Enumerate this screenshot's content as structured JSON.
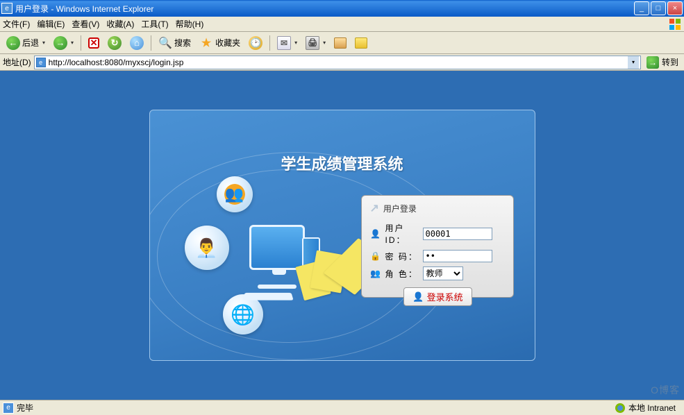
{
  "window": {
    "title": "用户登录 - Windows Internet Explorer",
    "btn_min": "_",
    "btn_max": "□",
    "btn_close": "×"
  },
  "menu": {
    "file": "文件(F)",
    "edit": "编辑(E)",
    "view": "查看(V)",
    "favorites": "收藏(A)",
    "tools": "工具(T)",
    "help": "帮助(H)"
  },
  "toolbar": {
    "back": "后退",
    "search": "搜索",
    "favorites": "收藏夹"
  },
  "address": {
    "label": "地址(D)",
    "url": "http://localhost:8080/myxscj/login.jsp",
    "go": "转到"
  },
  "app": {
    "title": "学生成绩管理系统"
  },
  "login": {
    "panel_title": "用户登录",
    "userid_label": "用户ID：",
    "userid_value": "00001",
    "password_label": "密 码：",
    "password_value": "••",
    "role_label": "角 色：",
    "role_value": "教师",
    "submit": "登录系统"
  },
  "status": {
    "text": "完毕",
    "zone": "本地 Intranet"
  },
  "watermark": "O博客"
}
